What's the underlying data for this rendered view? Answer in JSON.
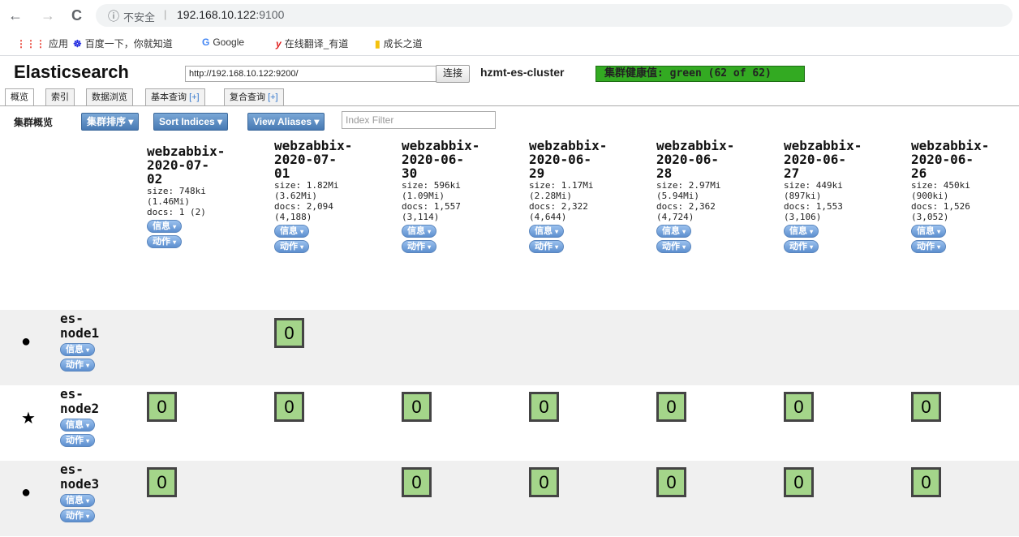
{
  "browser": {
    "back_icon": "←",
    "forward_icon": "→",
    "reload_icon": "C",
    "info_icon": "ⓘ",
    "insecure_label": "不安全",
    "url_host": "192.168.10.122",
    "url_port": ":9100",
    "bookmarks": [
      {
        "icon": "⋮⋮⋮",
        "label": "应用",
        "color": "#e94235"
      },
      {
        "icon": "☸",
        "label": "百度一下，你就知道",
        "color": "#2932e1"
      },
      {
        "icon": "G",
        "label": "Google",
        "color": "#4285f4"
      },
      {
        "icon": "y",
        "label": "在线翻译_有道",
        "color": "#e0201f"
      },
      {
        "icon": "▮",
        "label": "成长之道",
        "color": "#f4c20d"
      }
    ]
  },
  "app": {
    "title": "Elasticsearch",
    "connect_url": "http://192.168.10.122:9200/",
    "connect_label": "连接",
    "cluster_name": "hzmt-es-cluster",
    "health_label": "集群健康值: green (62 of 62)",
    "health_color": "#33aa22"
  },
  "tabs": [
    {
      "label": "概览",
      "plus": ""
    },
    {
      "label": "索引",
      "plus": ""
    },
    {
      "label": "数据浏览",
      "plus": ""
    },
    {
      "label": "基本查询",
      "plus": "[+]"
    },
    {
      "label": "复合查询",
      "plus": "[+]"
    }
  ],
  "toolbar": {
    "section_title": "集群概览",
    "sort_cluster": "集群排序",
    "sort_indices": "Sort Indices",
    "view_aliases": "View Aliases",
    "caret": "▾",
    "filter_placeholder": "Index Filter"
  },
  "pill_labels": {
    "info": "信息",
    "action": "动作"
  },
  "indices": [
    {
      "name_lines": [
        "webzabbix-",
        "2020-07-",
        "02"
      ],
      "size": "size: 748ki",
      "size_total": "(1.46Mi)",
      "docs": "docs: 1 (2)",
      "docs_total": ""
    },
    {
      "name_lines": [
        "webzabbix-",
        "2020-07-",
        "01"
      ],
      "size": "size: 1.82Mi",
      "size_total": "(3.62Mi)",
      "docs": "docs: 2,094",
      "docs_total": "(4,188)"
    },
    {
      "name_lines": [
        "webzabbix-",
        "2020-06-",
        "30"
      ],
      "size": "size: 596ki",
      "size_total": "(1.09Mi)",
      "docs": "docs: 1,557",
      "docs_total": "(3,114)"
    },
    {
      "name_lines": [
        "webzabbix-",
        "2020-06-",
        "29"
      ],
      "size": "size: 1.17Mi",
      "size_total": "(2.28Mi)",
      "docs": "docs: 2,322",
      "docs_total": "(4,644)"
    },
    {
      "name_lines": [
        "webzabbix-",
        "2020-06-",
        "28"
      ],
      "size": "size: 2.97Mi",
      "size_total": "(5.94Mi)",
      "docs": "docs: 2,362",
      "docs_total": "(4,724)"
    },
    {
      "name_lines": [
        "webzabbix-",
        "2020-06-",
        "27"
      ],
      "size": "size: 449ki",
      "size_total": "(897ki)",
      "docs": "docs: 1,553",
      "docs_total": "(3,106)"
    },
    {
      "name_lines": [
        "webzabbix-",
        "2020-06-",
        "26"
      ],
      "size": "size: 450ki",
      "size_total": "(900ki)",
      "docs": "docs: 1,526",
      "docs_total": "(3,052)"
    }
  ],
  "nodes": [
    {
      "name_lines": [
        "es-",
        "node1"
      ],
      "symbol": "●",
      "symbol_name": "node-dot-icon",
      "shards": [
        null,
        "0",
        null,
        null,
        null,
        null,
        null
      ]
    },
    {
      "name_lines": [
        "es-",
        "node2"
      ],
      "symbol": "★",
      "symbol_name": "master-star-icon",
      "shards": [
        "0",
        "0",
        "0",
        "0",
        "0",
        "0",
        "0"
      ]
    },
    {
      "name_lines": [
        "es-",
        "node3"
      ],
      "symbol": "●",
      "symbol_name": "node-dot-icon",
      "shards": [
        "0",
        null,
        "0",
        "0",
        "0",
        "0",
        "0"
      ]
    }
  ]
}
